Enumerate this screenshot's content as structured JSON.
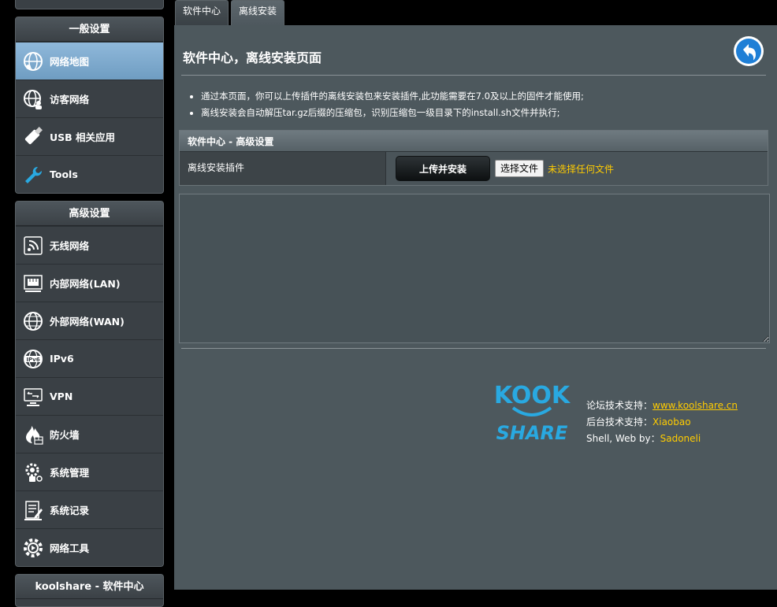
{
  "sidebar": {
    "general": {
      "header": "一般设置",
      "items": [
        {
          "label": "网络地图",
          "icon": "network-map-icon",
          "active": true
        },
        {
          "label": "访客网络",
          "icon": "guest-network-icon"
        },
        {
          "label": "USB 相关应用",
          "icon": "usb-icon"
        },
        {
          "label": "Tools",
          "icon": "wrench-icon"
        }
      ]
    },
    "advanced": {
      "header": "高级设置",
      "items": [
        {
          "label": "无线网络",
          "icon": "wireless-icon"
        },
        {
          "label": "内部网络(LAN)",
          "icon": "lan-icon"
        },
        {
          "label": "外部网络(WAN)",
          "icon": "wan-globe-icon"
        },
        {
          "label": "IPv6",
          "icon": "ipv6-icon"
        },
        {
          "label": "VPN",
          "icon": "vpn-icon"
        },
        {
          "label": "防火墙",
          "icon": "firewall-icon"
        },
        {
          "label": "系统管理",
          "icon": "admin-icon"
        },
        {
          "label": "系统记录",
          "icon": "log-icon"
        },
        {
          "label": "网络工具",
          "icon": "network-tools-icon"
        }
      ]
    },
    "koolshare_header": "koolshare - 软件中心"
  },
  "tabs": [
    "软件中心",
    "离线安装"
  ],
  "page": {
    "title": "软件中心，离线安装页面",
    "notes": [
      "通过本页面，你可以上传插件的离线安装包来安装插件,此功能需要在7.0及以上的固件才能使用;",
      "离线安装会自动解压tar.gz后缀的压缩包，识别压缩包一级目录下的install.sh文件并执行;"
    ],
    "table": {
      "header": "软件中心 - 高级设置",
      "row_label": "离线安装插件",
      "upload_button": "上传并安装",
      "file_button": "选择文件",
      "file_status": "未选择任何文件"
    },
    "log_text": ""
  },
  "footer": {
    "logo_top": "KOOK",
    "logo_bottom": "SHARE",
    "forum_label": "论坛技术支持：",
    "forum_link": "www.koolshare.cn",
    "backend_label": "后台技术支持：",
    "backend_value": "Xiaobao",
    "shell_label": "Shell, Web by：",
    "shell_value": "Sadoneli"
  },
  "colors": {
    "accent_yellow": "#ffcc00",
    "logo_blue": "#29a9e1",
    "active_menu": "#7fa9cd",
    "panel_bg": "#4d585d"
  }
}
